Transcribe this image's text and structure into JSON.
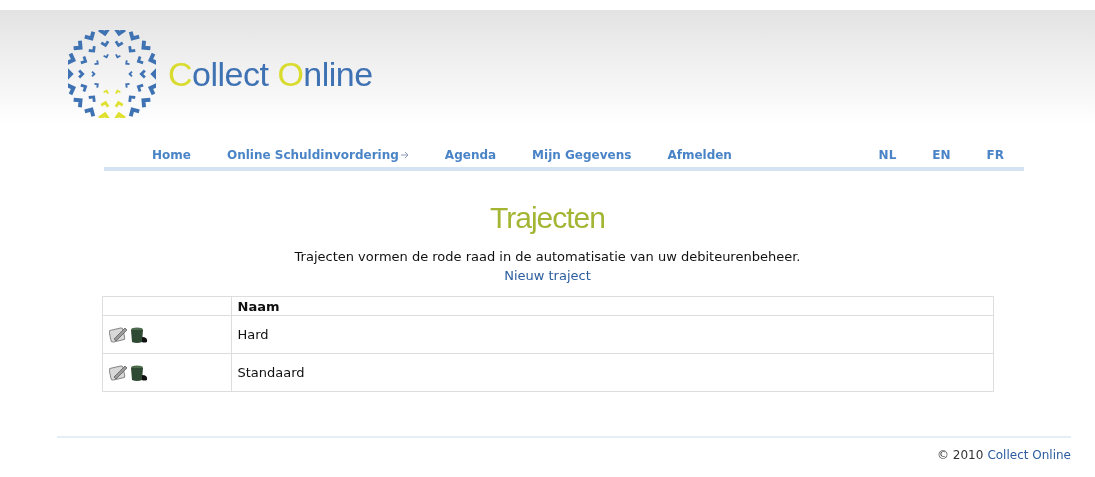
{
  "logo": {
    "parts": [
      {
        "text": "C",
        "accent": true
      },
      {
        "text": "ollect ",
        "accent": false
      },
      {
        "text": "O",
        "accent": true
      },
      {
        "text": "nline",
        "accent": false
      }
    ]
  },
  "nav": [
    {
      "label": "Home",
      "has_submenu": false
    },
    {
      "label": "Online Schuldinvordering",
      "has_submenu": true
    },
    {
      "label": "Agenda",
      "has_submenu": false
    },
    {
      "label": "Mijn Gegevens",
      "has_submenu": false
    },
    {
      "label": "Afmelden",
      "has_submenu": false
    }
  ],
  "languages": [
    "NL",
    "EN",
    "FR"
  ],
  "page_title": "Trajecten",
  "intro": "Trajecten vormen de rode raad in de automatisatie van uw debiteurenbeheer.",
  "new_link": "Nieuw traject",
  "table": {
    "columns": [
      "Naam"
    ],
    "rows": [
      {
        "name": "Hard"
      },
      {
        "name": "Standaard"
      }
    ]
  },
  "footer": {
    "copyright": "© 2010",
    "link": "Collect Online"
  }
}
